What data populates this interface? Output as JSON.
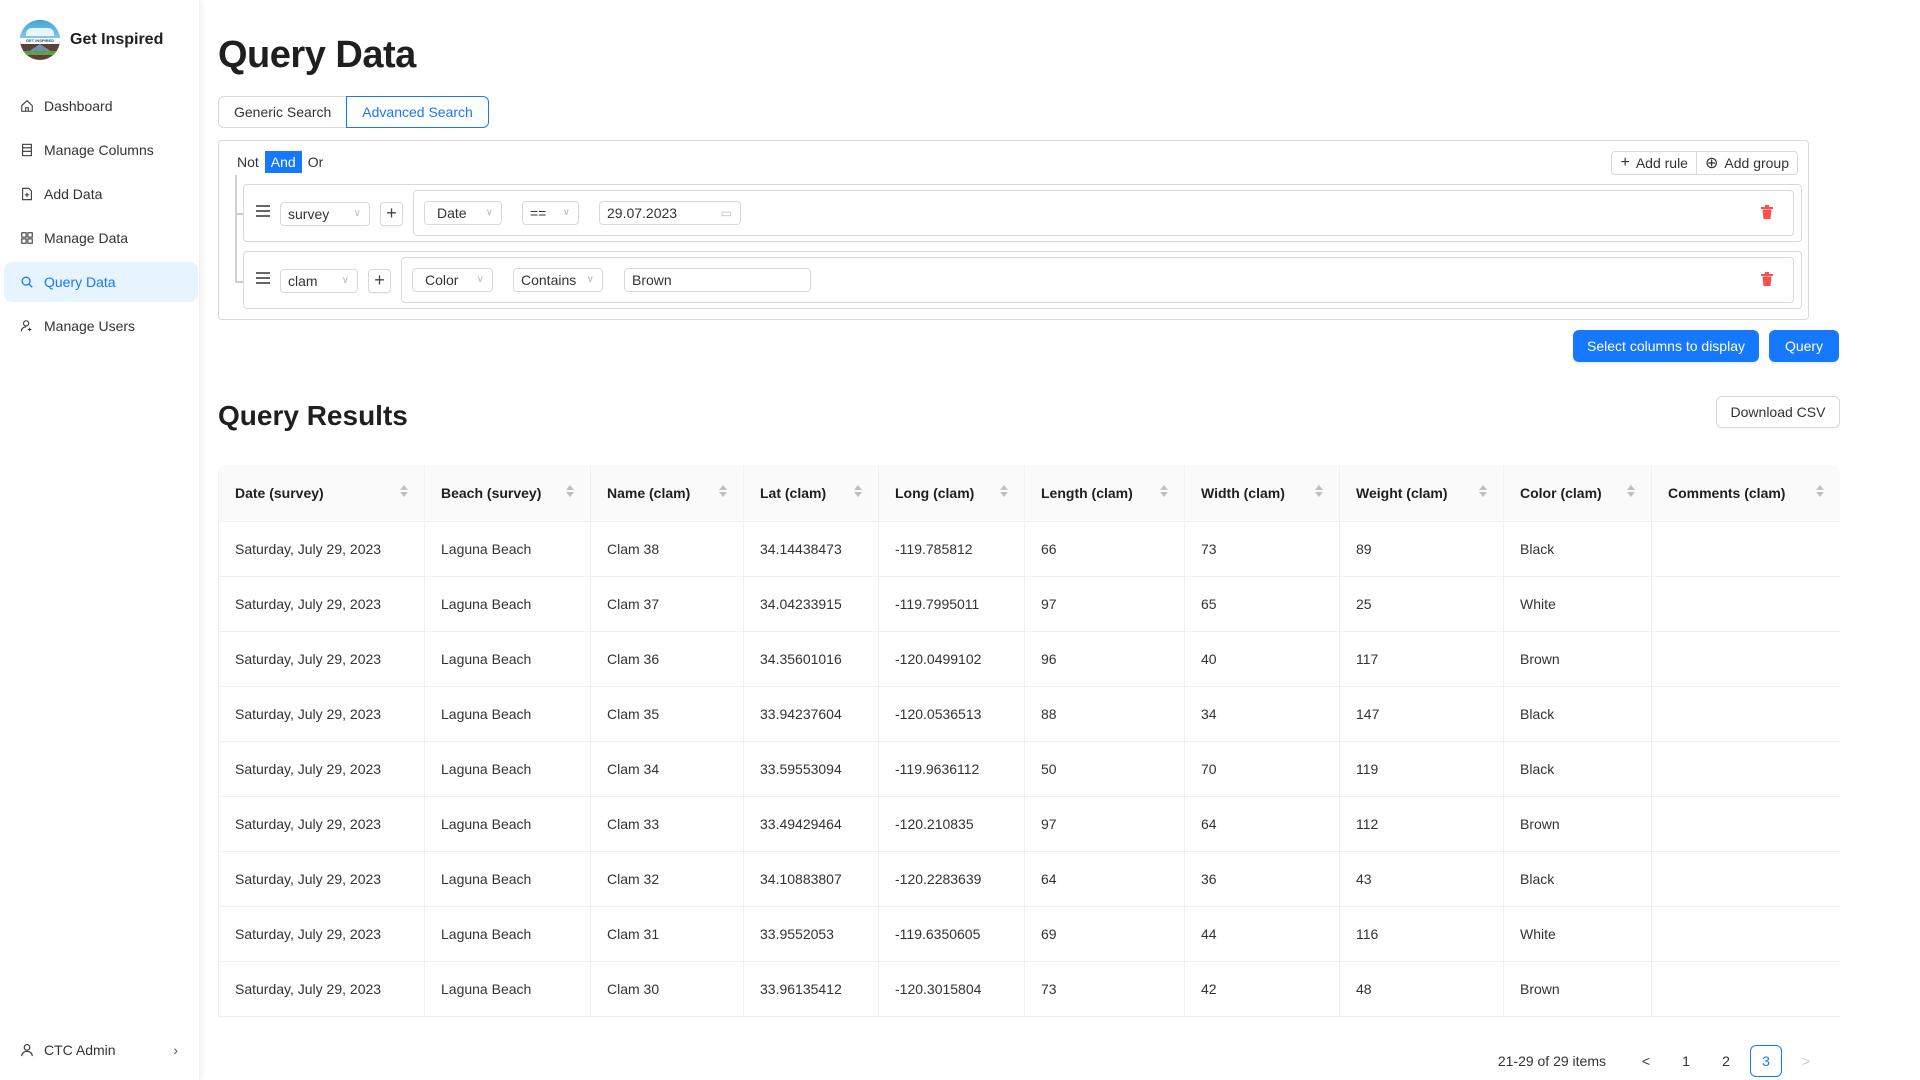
{
  "app": {
    "brand_name": "Get Inspired",
    "logo_text": "GET INSPIRED"
  },
  "sidebar": {
    "items": [
      {
        "label": "Dashboard",
        "icon": "home-icon",
        "active": false
      },
      {
        "label": "Manage Columns",
        "icon": "columns-icon",
        "active": false
      },
      {
        "label": "Add Data",
        "icon": "file-add-icon",
        "active": false
      },
      {
        "label": "Manage Data",
        "icon": "grid-icon",
        "active": false
      },
      {
        "label": "Query Data",
        "icon": "search-icon",
        "active": true
      },
      {
        "label": "Manage Users",
        "icon": "users-icon",
        "active": false
      }
    ],
    "user": {
      "name": "CTC Admin",
      "chevron": "›"
    }
  },
  "page": {
    "title": "Query Data",
    "tabs": [
      {
        "label": "Generic Search",
        "active": false
      },
      {
        "label": "Advanced Search",
        "active": true
      }
    ]
  },
  "query_builder": {
    "combinators": [
      {
        "label": "Not",
        "active": false
      },
      {
        "label": "And",
        "active": true
      },
      {
        "label": "Or",
        "active": false
      }
    ],
    "add_rule_label": "Add rule",
    "add_group_label": "Add group",
    "rules": [
      {
        "table": "survey",
        "field": "Date",
        "operator": "==",
        "value": "29.07.2023",
        "value_type": "date"
      },
      {
        "table": "clam",
        "field": "Color",
        "operator": "Contains",
        "value": "Brown",
        "value_type": "text"
      }
    ],
    "plus_label": "+",
    "caret": "∨"
  },
  "actions": {
    "select_columns_label": "Select columns to display",
    "query_label": "Query"
  },
  "results": {
    "title": "Query Results",
    "download_label": "Download CSV",
    "columns": [
      "Date (survey)",
      "Beach (survey)",
      "Name (clam)",
      "Lat (clam)",
      "Long (clam)",
      "Length (clam)",
      "Width (clam)",
      "Weight (clam)",
      "Color (clam)",
      "Comments (clam)"
    ],
    "rows": [
      [
        "Saturday, July 29, 2023",
        "Laguna Beach",
        "Clam 38",
        "34.14438473",
        "-119.785812",
        "66",
        "73",
        "89",
        "Black",
        ""
      ],
      [
        "Saturday, July 29, 2023",
        "Laguna Beach",
        "Clam 37",
        "34.04233915",
        "-119.7995011",
        "97",
        "65",
        "25",
        "White",
        ""
      ],
      [
        "Saturday, July 29, 2023",
        "Laguna Beach",
        "Clam 36",
        "34.35601016",
        "-120.0499102",
        "96",
        "40",
        "117",
        "Brown",
        ""
      ],
      [
        "Saturday, July 29, 2023",
        "Laguna Beach",
        "Clam 35",
        "33.94237604",
        "-120.0536513",
        "88",
        "34",
        "147",
        "Black",
        ""
      ],
      [
        "Saturday, July 29, 2023",
        "Laguna Beach",
        "Clam 34",
        "33.59553094",
        "-119.9636112",
        "50",
        "70",
        "119",
        "Black",
        ""
      ],
      [
        "Saturday, July 29, 2023",
        "Laguna Beach",
        "Clam 33",
        "33.49429464",
        "-120.210835",
        "97",
        "64",
        "112",
        "Brown",
        ""
      ],
      [
        "Saturday, July 29, 2023",
        "Laguna Beach",
        "Clam 32",
        "34.10883807",
        "-120.2283639",
        "64",
        "36",
        "43",
        "Black",
        ""
      ],
      [
        "Saturday, July 29, 2023",
        "Laguna Beach",
        "Clam 31",
        "33.9552053",
        "-119.6350605",
        "69",
        "44",
        "116",
        "White",
        ""
      ],
      [
        "Saturday, July 29, 2023",
        "Laguna Beach",
        "Clam 30",
        "33.96135412",
        "-120.3015804",
        "73",
        "42",
        "48",
        "Brown",
        ""
      ]
    ]
  },
  "pagination": {
    "summary": "21-29 of 29 items",
    "prev": "<",
    "next": ">",
    "pages": [
      "1",
      "2",
      "3"
    ],
    "current": "3"
  },
  "colors": {
    "primary": "#1677ff",
    "active_bg": "#e6f4ff",
    "danger": "#ff4d4f"
  }
}
